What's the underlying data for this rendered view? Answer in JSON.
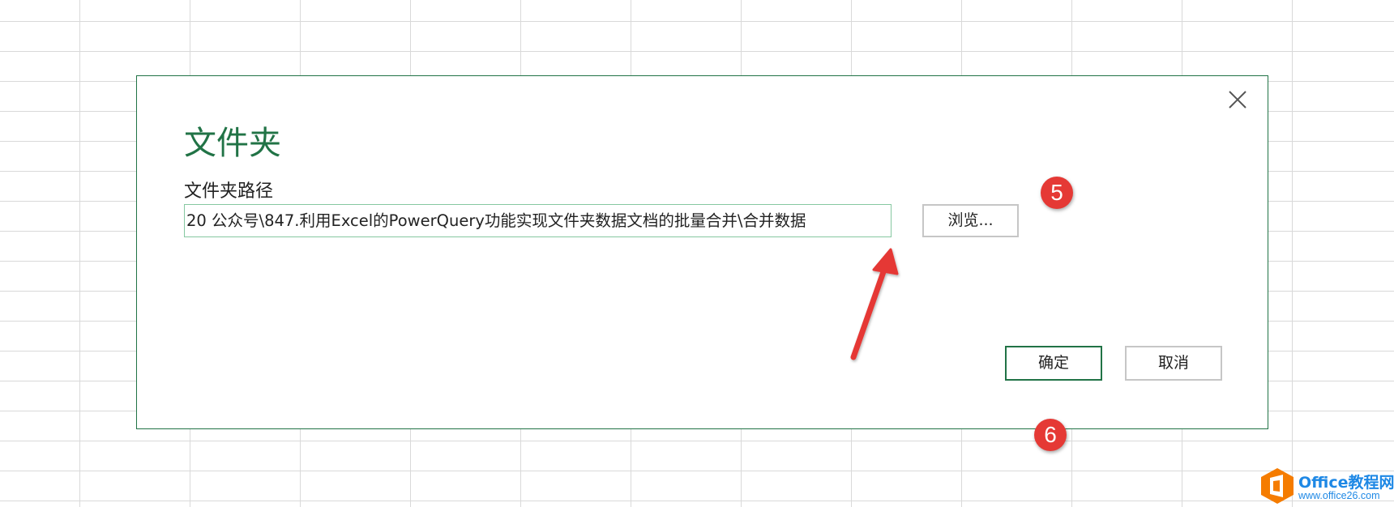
{
  "dialog": {
    "title": "文件夹",
    "path_label": "文件夹路径",
    "path_value": "20 公众号\\847.利用Excel的PowerQuery功能实现文件夹数据文档的批量合并\\合并数据",
    "browse_label": "浏览...",
    "ok_label": "确定",
    "cancel_label": "取消",
    "close_icon": "close-icon"
  },
  "annotations": {
    "badge_5": "5",
    "badge_6": "6"
  },
  "watermark": {
    "name": "Office教程网",
    "url": "www.office26.com",
    "logo_icon": "office-logo-icon"
  },
  "colors": {
    "accent": "#217346",
    "badge": "#e53935",
    "grid": "#d9d9d9",
    "watermark": "#1e88e5",
    "logo": "#f57c00"
  }
}
